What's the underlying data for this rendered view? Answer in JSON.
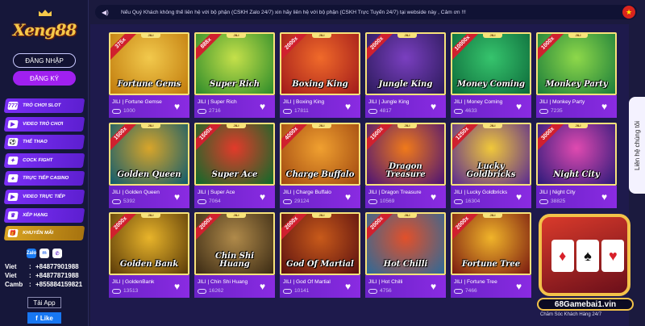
{
  "sidebar": {
    "logo": "Xeng88",
    "login_label": "ĐĂNG NHẬP",
    "register_label": "ĐĂNG KÝ",
    "menu": [
      {
        "label": "TRÒ CHƠI SLOT",
        "icon": "slot-icon",
        "glyph": "777"
      },
      {
        "label": "VIDEO TRÒ CHƠI",
        "icon": "video-game-icon",
        "glyph": "▶"
      },
      {
        "label": "THỂ THAO",
        "icon": "sports-icon",
        "glyph": "⚽"
      },
      {
        "label": "COCK FIGHT",
        "icon": "cock-fight-icon",
        "glyph": "✦"
      },
      {
        "label": "TRỰC TIẾP CASINO",
        "icon": "live-casino-icon",
        "glyph": "♠"
      },
      {
        "label": "VIDEO TRỰC TIẾP",
        "icon": "live-video-icon",
        "glyph": "▶"
      },
      {
        "label": "XẾP HẠNG",
        "icon": "ranking-icon",
        "glyph": "♛"
      },
      {
        "label": "KHUYẾN MÃI",
        "icon": "promotion-icon",
        "glyph": "🎁"
      }
    ],
    "social": {
      "zalo": "Zalo",
      "messenger": "m",
      "phone": "✆"
    },
    "contacts": [
      {
        "label": "Viet",
        "number": "+84877901988"
      },
      {
        "label": "Viet",
        "number": "+84877871988"
      },
      {
        "label": "Camb",
        "number": "+855884159821"
      }
    ],
    "app_label": "Tải App",
    "like_label": "Like"
  },
  "topbar": {
    "marquee": "Nếu Quý Khách không thể liên hệ với bộ phận (CSKH Zalo 24/7) xin hãy liên hệ với bộ phận (CSKH Trực Tuyến 24/7) tại webside này , Cảm ơn !!!",
    "flag": "★"
  },
  "games": [
    {
      "title": "Fortune Gems",
      "name": "JILI | Fortune Gemse",
      "plays": "1000",
      "badge": "375x",
      "colors": [
        "#c07a0c",
        "#f2c94c"
      ]
    },
    {
      "title": "Super Rich",
      "name": "JILI | Super Rich",
      "plays": "2716",
      "badge": "888x",
      "colors": [
        "#2c8b2a",
        "#c5e04a"
      ]
    },
    {
      "title": "Boxing King",
      "name": "JILI | Boxing King",
      "plays": "17811",
      "badge": "2000x",
      "colors": [
        "#a11a1a",
        "#f06a2a"
      ]
    },
    {
      "title": "Jungle King",
      "name": "JILI | Jungle King",
      "plays": "4817",
      "badge": "2000x",
      "colors": [
        "#2b1a5a",
        "#7a3fc0"
      ]
    },
    {
      "title": "Money Coming",
      "name": "JILI | Money Coming",
      "plays": "4633",
      "badge": "10000x",
      "colors": [
        "#0d6a3a",
        "#36c46d"
      ]
    },
    {
      "title": "Monkey Party",
      "name": "JILI | Monkey Party",
      "plays": "7235",
      "badge": "1000x",
      "colors": [
        "#1a7d3a",
        "#8ed84a"
      ]
    },
    {
      "title": "Golden Queen",
      "name": "JILI | Golden Queen",
      "plays": "5392",
      "badge": "1500x",
      "colors": [
        "#0e5b6e",
        "#d8a52a"
      ]
    },
    {
      "title": "Super Ace",
      "name": "JILI | Super Ace",
      "plays": "7064",
      "badge": "1500x",
      "colors": [
        "#0b6b2a",
        "#e33a2a"
      ]
    },
    {
      "title": "Charge Buffalo",
      "name": "JILI | Charge Buffalo",
      "plays": "29124",
      "badge": "4000x",
      "colors": [
        "#a04810",
        "#f0a030"
      ]
    },
    {
      "title": "Dragon Treasure",
      "name": "JILI | Dragon Treasure",
      "plays": "10569",
      "badge": "1500x",
      "colors": [
        "#4a1276",
        "#f07a1a"
      ]
    },
    {
      "title": "Lucky Goldbricks",
      "name": "JILI | Lucky Goldbricks",
      "plays": "16304",
      "badge": "1250x",
      "colors": [
        "#5a2a90",
        "#f0c83a"
      ]
    },
    {
      "title": "Night City",
      "name": "JILI | Night City",
      "plays": "38825",
      "badge": "3000x",
      "colors": [
        "#2a1a7a",
        "#e04ab0"
      ]
    },
    {
      "title": "Golden Bank",
      "name": "JILI | GoldenBank",
      "plays": "13513",
      "badge": "2000x",
      "colors": [
        "#5a3a08",
        "#e8b42a"
      ]
    },
    {
      "title": "Chin Shi Huang",
      "name": "JILI | Chin Shi Huang",
      "plays": "16262",
      "badge": "2000x",
      "colors": [
        "#3a2a14",
        "#b08a4a"
      ]
    },
    {
      "title": "God Of Martial",
      "name": "JILI | God Of Martial",
      "plays": "10141",
      "badge": "2000x",
      "colors": [
        "#5a1010",
        "#c85a1a"
      ]
    },
    {
      "title": "Hot Chilli",
      "name": "JILI | Hot Chilli",
      "plays": "4756",
      "badge": "2000x",
      "colors": [
        "#2a6a9a",
        "#e2502a"
      ]
    },
    {
      "title": "Fortune Tree",
      "name": "JILI | Fortune Tree",
      "plays": "7466",
      "badge": "2000x",
      "colors": [
        "#7a1a10",
        "#f0b42a"
      ]
    }
  ],
  "side_tab": "Liên hệ chúng tôi",
  "promo": {
    "url": "68Gamebai1.vin",
    "care": "Chăm Sóc Khách Hàng 24/7"
  }
}
